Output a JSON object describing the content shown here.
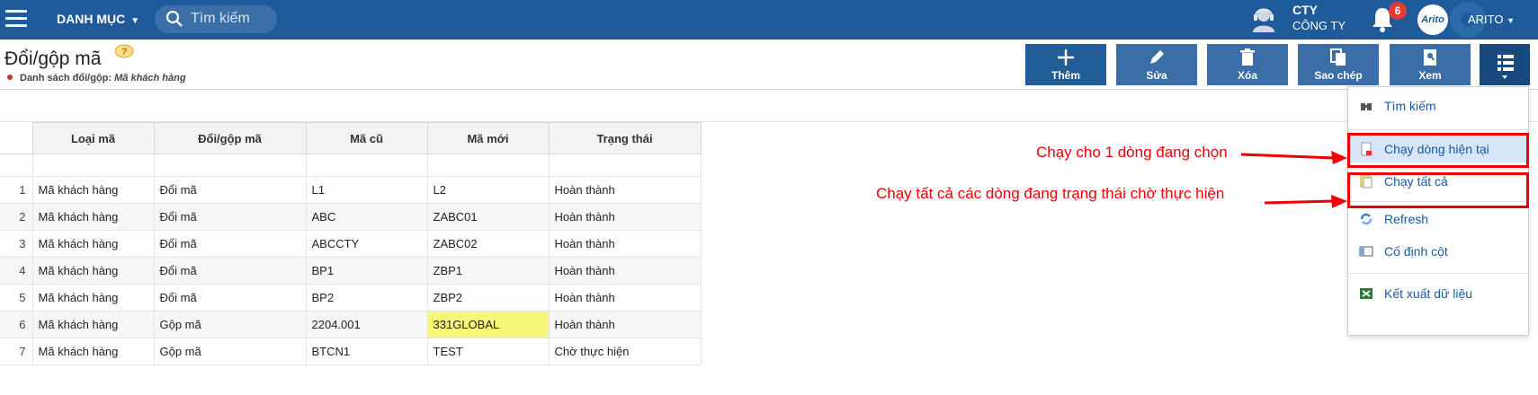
{
  "topbar": {
    "menu_label": "DANH MỤC",
    "search_placeholder": "Tìm kiếm",
    "company_line1": "CTY",
    "company_line2": "CÔNG TY",
    "notification_count": "6",
    "avatar_text": "Arito",
    "user_label": "ARITO"
  },
  "page": {
    "title": "Đổi/gộp mã",
    "subtitle_prefix": "Danh sách đổi/gộp:",
    "subtitle_value": "Mã khách hàng"
  },
  "toolbar": {
    "add": "Thêm",
    "edit": "Sửa",
    "delete": "Xóa",
    "copy": "Sao chép",
    "view": "Xem"
  },
  "table": {
    "columns": [
      "Loại mã",
      "Đổi/gộp mã",
      "Mã cũ",
      "Mã mới",
      "Trạng thái"
    ],
    "rows": [
      [
        "1",
        "Mã khách hàng",
        "Đổi mã",
        "L1",
        "L2",
        "Hoàn thành"
      ],
      [
        "2",
        "Mã khách hàng",
        "Đổi mã",
        "ABC",
        "ZABC01",
        "Hoàn thành"
      ],
      [
        "3",
        "Mã khách hàng",
        "Đổi mã",
        "ABCCTY",
        "ZABC02",
        "Hoàn thành"
      ],
      [
        "4",
        "Mã khách hàng",
        "Đổi mã",
        "BP1",
        "ZBP1",
        "Hoàn thành"
      ],
      [
        "5",
        "Mã khách hàng",
        "Đổi mã",
        "BP2",
        "ZBP2",
        "Hoàn thành"
      ],
      [
        "6",
        "Mã khách hàng",
        "Gộp mã",
        "2204.001",
        "331GLOBAL",
        "Hoàn thành"
      ],
      [
        "7",
        "Mã khách hàng",
        "Gộp mã",
        "BTCN1",
        "TEST",
        "Chờ thực hiện"
      ]
    ]
  },
  "menu": {
    "search": "Tìm kiếm",
    "run_current": "Chạy dòng hiện tại",
    "run_all": "Chạy tất cả",
    "refresh": "Refresh",
    "freeze_column": "Cố định cột",
    "export": "Kết xuất dữ liệu"
  },
  "annotations": {
    "run_current_note": "Chạy cho 1 dòng đang chọn",
    "run_all_note": "Chạy tất cả các dòng đang trạng thái chờ thực hiện"
  },
  "colors": {
    "header_bg": "#1f5a9a",
    "button_bg": "#235d97",
    "highlight_cell": "#f8f77a",
    "annotation_red": "#e00000",
    "menu_link": "#1a5aa3"
  }
}
